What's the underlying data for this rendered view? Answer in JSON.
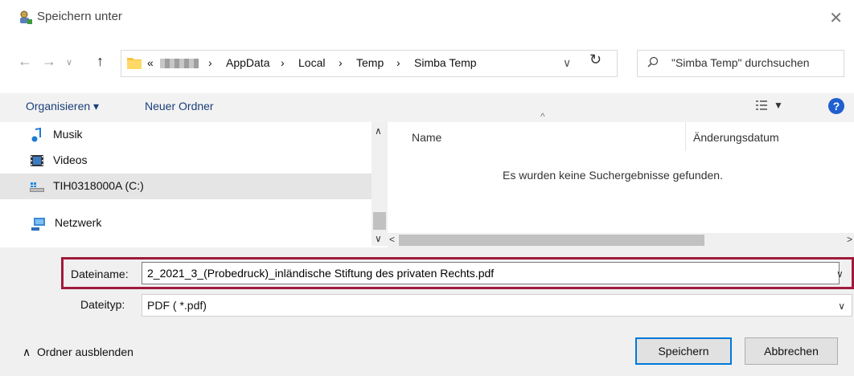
{
  "window": {
    "title": "Speichern unter",
    "title_icon": "save-as-icon",
    "close_icon": "close-icon"
  },
  "nav": {
    "back_icon": "back-arrow-icon",
    "forward_icon": "forward-arrow-icon",
    "recent_icon": "chevron-down-icon",
    "up_icon": "up-arrow-icon"
  },
  "address": {
    "prefix": "«",
    "crumbs": [
      "AppData",
      "Local",
      "Temp",
      "Simba Temp"
    ],
    "separator": "›",
    "folder_icon": "folder-icon",
    "refresh_icon": "refresh-icon"
  },
  "search": {
    "placeholder": "\"Simba Temp\" durchsuchen",
    "icon": "search-icon"
  },
  "toolbar": {
    "organize": "Organisieren ▾",
    "new_folder": "Neuer Ordner",
    "view_icon": "view-options-icon",
    "help_icon": "help-icon",
    "help_label": "?"
  },
  "sidebar": {
    "items": [
      {
        "label": "Musik",
        "icon": "music-icon"
      },
      {
        "label": "Videos",
        "icon": "videos-icon"
      },
      {
        "label": "TIH0318000A (C:)",
        "icon": "drive-icon",
        "selected": true
      },
      {
        "label": "Netzwerk",
        "icon": "network-icon"
      }
    ]
  },
  "file_list": {
    "columns": [
      "Name",
      "Änderungsdatum"
    ],
    "empty_message": "Es wurden keine Suchergebnisse gefunden."
  },
  "form": {
    "filename_label": "Dateiname:",
    "filename_value": "2_2021_3_(Probedruck)_inländische Stiftung des privaten Rechts.pdf",
    "filetype_label": "Dateityp:",
    "filetype_value": "PDF ( *.pdf)",
    "highlight_color": "#a01b3b"
  },
  "footer": {
    "hide_folders": "Ordner ausblenden",
    "save": "Speichern",
    "cancel": "Abbrechen"
  }
}
